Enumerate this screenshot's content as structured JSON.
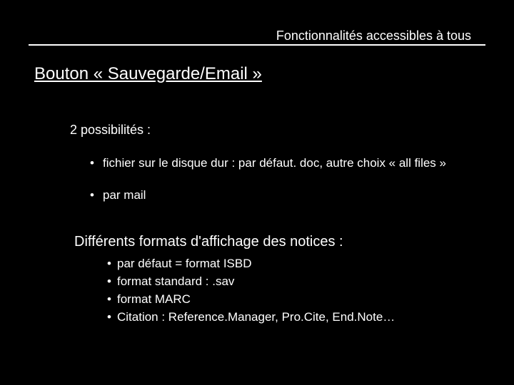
{
  "header": {
    "context": "Fonctionnalités accessibles à tous"
  },
  "title": "Bouton « Sauvegarde/Email »",
  "intro": "2 possibilités  :",
  "possibilities": [
    "fichier sur le disque dur : par défaut. doc, autre choix « all files »",
    "par mail"
  ],
  "formats_heading": "Différents formats d'affichage des notices :",
  "formats": [
    "par défaut = format ISBD",
    "format standard : .sav",
    "format MARC",
    "Citation : Reference.Manager, Pro.Cite, End.Note…"
  ]
}
